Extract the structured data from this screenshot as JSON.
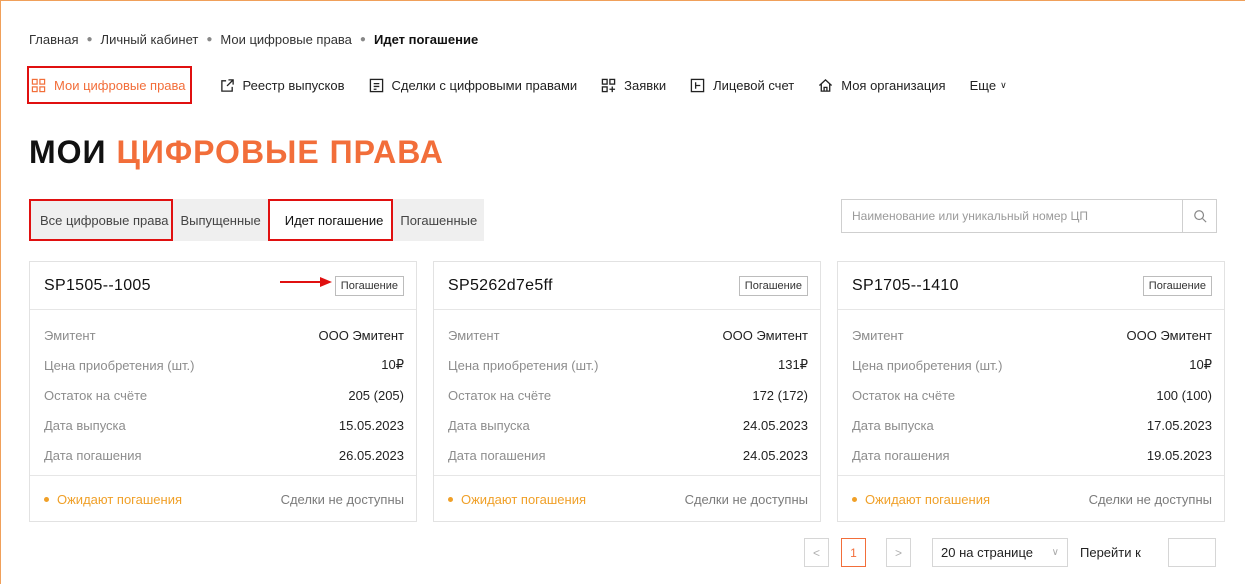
{
  "breadcrumb": [
    {
      "label": "Главная"
    },
    {
      "label": "Личный кабинет"
    },
    {
      "label": "Мои цифровые права"
    },
    {
      "label": "Идет погашение"
    }
  ],
  "nav": {
    "items": [
      {
        "label": "Мои цифровые права",
        "icon": "grid-icon"
      },
      {
        "label": "Реестр выпусков",
        "icon": "external-link-icon"
      },
      {
        "label": "Сделки с цифровыми правами",
        "icon": "document-icon"
      },
      {
        "label": "Заявки",
        "icon": "apps-add-icon"
      },
      {
        "label": "Лицевой счет",
        "icon": "account-icon"
      },
      {
        "label": "Моя организация",
        "icon": "home-icon"
      }
    ],
    "more_label": "Еще"
  },
  "title": {
    "part1": "МОИ",
    "part2": "ЦИФРОВЫЕ ПРАВА"
  },
  "tabs": [
    "Все цифровые права",
    "Выпущенные",
    "Идет погашение",
    "Погашенные"
  ],
  "search": {
    "placeholder": "Наименование или уникальный номер ЦП"
  },
  "cards": [
    {
      "code": "SP1505--1005",
      "badge": "Погашение",
      "rows": [
        {
          "key": "Эмитент",
          "value": "ООО Эмитент"
        },
        {
          "key": "Цена приобретения (шт.)",
          "value": "10₽"
        },
        {
          "key": "Остаток на счёте",
          "value": "205 (205)"
        },
        {
          "key": "Дата выпуска",
          "value": "15.05.2023"
        },
        {
          "key": "Дата погашения",
          "value": "26.05.2023"
        }
      ],
      "status": "Ожидают погашения",
      "deals": "Сделки не доступны"
    },
    {
      "code": "SP5262d7e5ff",
      "badge": "Погашение",
      "rows": [
        {
          "key": "Эмитент",
          "value": "ООО Эмитент"
        },
        {
          "key": "Цена приобретения (шт.)",
          "value": "131₽"
        },
        {
          "key": "Остаток на счёте",
          "value": "172 (172)"
        },
        {
          "key": "Дата выпуска",
          "value": "24.05.2023"
        },
        {
          "key": "Дата погашения",
          "value": "24.05.2023"
        }
      ],
      "status": "Ожидают погашения",
      "deals": "Сделки не доступны"
    },
    {
      "code": "SP1705--1410",
      "badge": "Погашение",
      "rows": [
        {
          "key": "Эмитент",
          "value": "ООО Эмитент"
        },
        {
          "key": "Цена приобретения (шт.)",
          "value": "10₽"
        },
        {
          "key": "Остаток на счёте",
          "value": "100 (100)"
        },
        {
          "key": "Дата выпуска",
          "value": "17.05.2023"
        },
        {
          "key": "Дата погашения",
          "value": "19.05.2023"
        }
      ],
      "status": "Ожидают погашения",
      "deals": "Сделки не доступны"
    }
  ],
  "pagination": {
    "prev": "<",
    "current": "1",
    "next": ">",
    "page_size_label": "20 на странице",
    "goto_label": "Перейти к"
  },
  "colors": {
    "accent": "#f26e3a",
    "highlight": "#e01010",
    "status": "#f0a028"
  }
}
